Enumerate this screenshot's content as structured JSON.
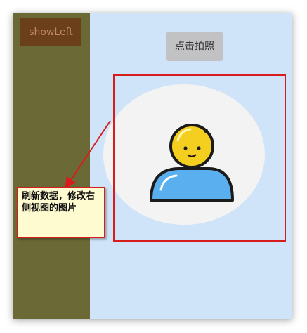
{
  "sidebar": {
    "show_left_label": "showLeft"
  },
  "main": {
    "photo_button_label": "点击拍照",
    "avatar_icon": "user-avatar-icon"
  },
  "annotation": {
    "note_text": "刷新数据，修改右侧视图的图片"
  },
  "colors": {
    "sidebar_bg": "#6b6a36",
    "sidebar_button_bg": "#6b3f1a",
    "main_bg": "#cfe4f8",
    "photo_button_bg": "#c2c2c4",
    "annotation_red": "#d81b1b",
    "note_bg": "#fffbd0"
  }
}
